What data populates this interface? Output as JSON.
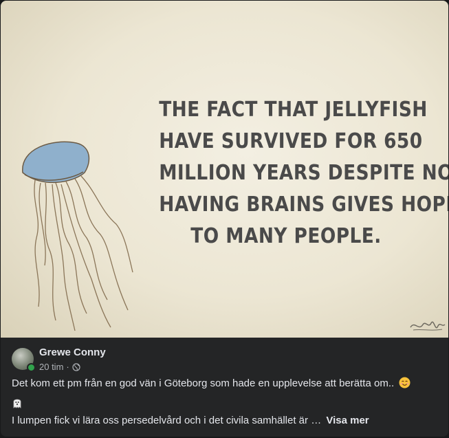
{
  "image": {
    "lines": [
      "THE FACT THAT JELLYFISH",
      "HAVE SURVIVED FOR 650",
      "MILLION YEARS DESPITE NOT",
      "HAVING BRAINS GIVES HOPE",
      "TO MANY PEOPLE."
    ],
    "illustration_icon": "jellyfish-illustration",
    "signature": "artist-signature"
  },
  "post": {
    "author": "Grewe Conny",
    "time": "20 tim",
    "separator": "·",
    "privacy_icon": "globe-icon",
    "online": true,
    "text_line1": "Det kom ett pm från en god vän i Göteborg som hade en upplevelse att berätta om..",
    "emoji1": "smiling-face-emoji",
    "emoji2": "ghost-emoji",
    "text_line2": "I lumpen fick vi lära oss persedelvård och i det civila samhället är …",
    "see_more": "Visa mer"
  },
  "colors": {
    "card_bg": "#242526",
    "text_primary": "#e4e6eb",
    "text_secondary": "#b0b3b8",
    "online": "#31a24c",
    "jelly_bell": "#8fb0cc"
  }
}
